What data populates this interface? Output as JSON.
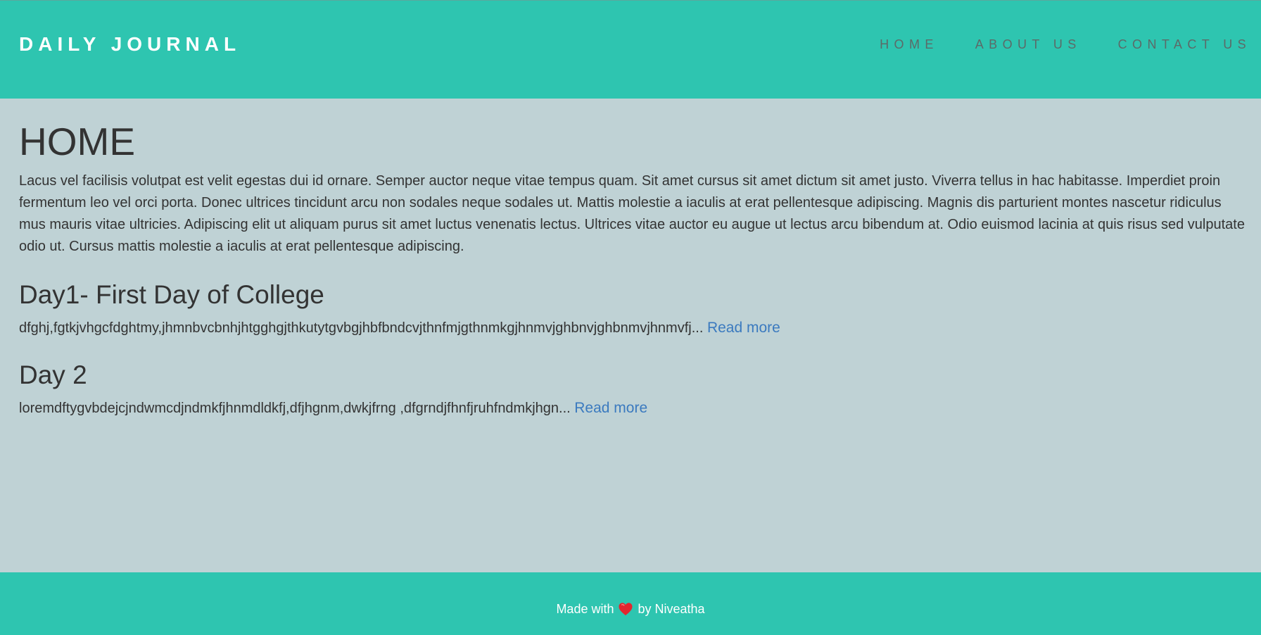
{
  "header": {
    "brand": "DAILY JOURNAL",
    "nav": [
      {
        "label": "HOME"
      },
      {
        "label": "ABOUT US"
      },
      {
        "label": "CONTACT US"
      }
    ]
  },
  "main": {
    "title": "HOME",
    "intro": "Lacus vel facilisis volutpat est velit egestas dui id ornare. Semper auctor neque vitae tempus quam. Sit amet cursus sit amet dictum sit amet justo. Viverra tellus in hac habitasse. Imperdiet proin fermentum leo vel orci porta. Donec ultrices tincidunt arcu non sodales neque sodales ut. Mattis molestie a iaculis at erat pellentesque adipiscing. Magnis dis parturient montes nascetur ridiculus mus mauris vitae ultricies. Adipiscing elit ut aliquam purus sit amet luctus venenatis lectus. Ultrices vitae auctor eu augue ut lectus arcu bibendum at. Odio euismod lacinia at quis risus sed vulputate odio ut. Cursus mattis molestie a iaculis at erat pellentesque adipiscing.",
    "posts": [
      {
        "title": "Day1- First Day of College",
        "excerpt": "dfghj,fgtkjvhgcfdghtmy,jhmnbvcbnhjhtgghgjthkutytgvbgjhbfbndcvjthnfmjgthnmkgjhnmvjghbnvjghbnmvjhnmvfj...",
        "read_more": "Read more"
      },
      {
        "title": "Day 2",
        "excerpt": "loremdftygvbdejcjndwmcdjndmkfjhnmdldkfj,dfjhgnm,dwkjfrng ,dfgrndjfhnfjruhfndmkjhgn...",
        "read_more": "Read more"
      }
    ]
  },
  "footer": {
    "prefix": "Made with",
    "heart_icon": "heart-icon",
    "suffix": "by Niveatha"
  },
  "colors": {
    "header_bg": "#2ec5b0",
    "page_bg": "#bfd2d5",
    "link": "#3b7abf",
    "text": "#333333"
  }
}
